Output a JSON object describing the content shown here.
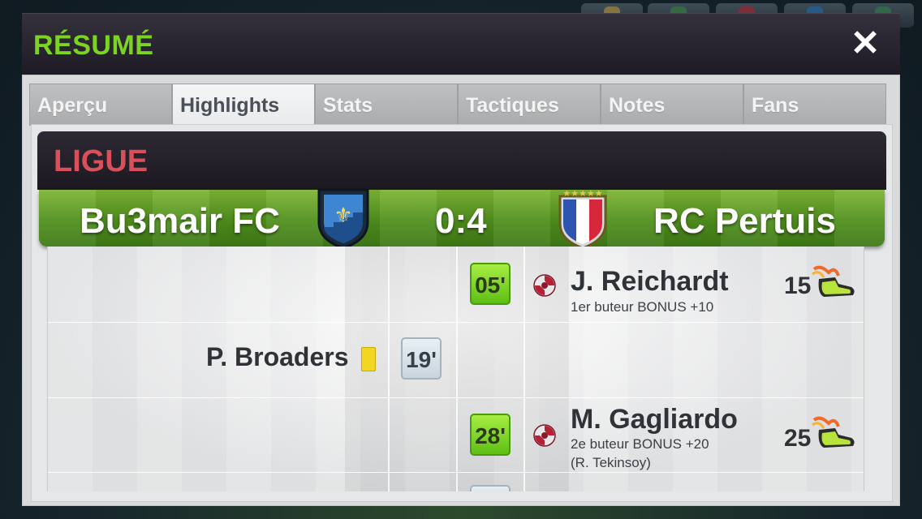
{
  "dialog": {
    "title": "RÉSUMÉ",
    "close_icon": "close-icon"
  },
  "tabs": [
    {
      "label": "Aperçu",
      "active": false
    },
    {
      "label": "Highlights",
      "active": true
    },
    {
      "label": "Stats",
      "active": false
    },
    {
      "label": "Tactiques",
      "active": false
    },
    {
      "label": "Notes",
      "active": false
    },
    {
      "label": "Fans",
      "active": false
    }
  ],
  "match": {
    "competition": "LIGUE",
    "home_team": "Bu3mair FC",
    "away_team": "RC Pertuis",
    "score": "0:4",
    "home_crest": "blue-shield-fleur-de-lis",
    "away_crest": "french-flag-shield-stars"
  },
  "events": [
    {
      "side": "away",
      "type": "goal",
      "minute": "05'",
      "player": "J. Reichardt",
      "detail": "1er buteur BONUS +10",
      "assist": "",
      "rating": "15"
    },
    {
      "side": "home",
      "type": "yellow-card",
      "minute": "19'",
      "player": "P. Broaders"
    },
    {
      "side": "away",
      "type": "goal",
      "minute": "28'",
      "player": "M. Gagliardo",
      "detail": "2e buteur BONUS +20",
      "assist": "(R. Tekinsoy)",
      "rating": "25"
    }
  ],
  "colors": {
    "title_green": "#7dd321",
    "league_red": "#d9505a",
    "goal_green": "#7ed321",
    "yellow_card": "#f2d622"
  }
}
